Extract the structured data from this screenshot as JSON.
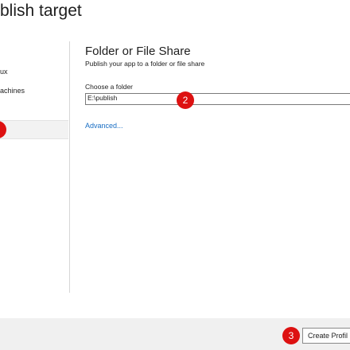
{
  "window": {
    "title": "blish target"
  },
  "sidebar": {
    "items": [
      {
        "label": "ux"
      },
      {
        "label": "achines"
      },
      {
        "label": ""
      }
    ]
  },
  "main": {
    "heading": "Folder or File Share",
    "subheading": "Publish your app to a folder or file share",
    "folder_label": "Choose a folder",
    "folder_value": "E:\\publish",
    "advanced_link": "Advanced..."
  },
  "footer": {
    "create_button": "Create Profil"
  },
  "markers": [
    {
      "label": ""
    },
    {
      "label": "2"
    },
    {
      "label": "3"
    }
  ],
  "colors": {
    "marker": "#dd1111",
    "link": "#1a6fc4"
  }
}
